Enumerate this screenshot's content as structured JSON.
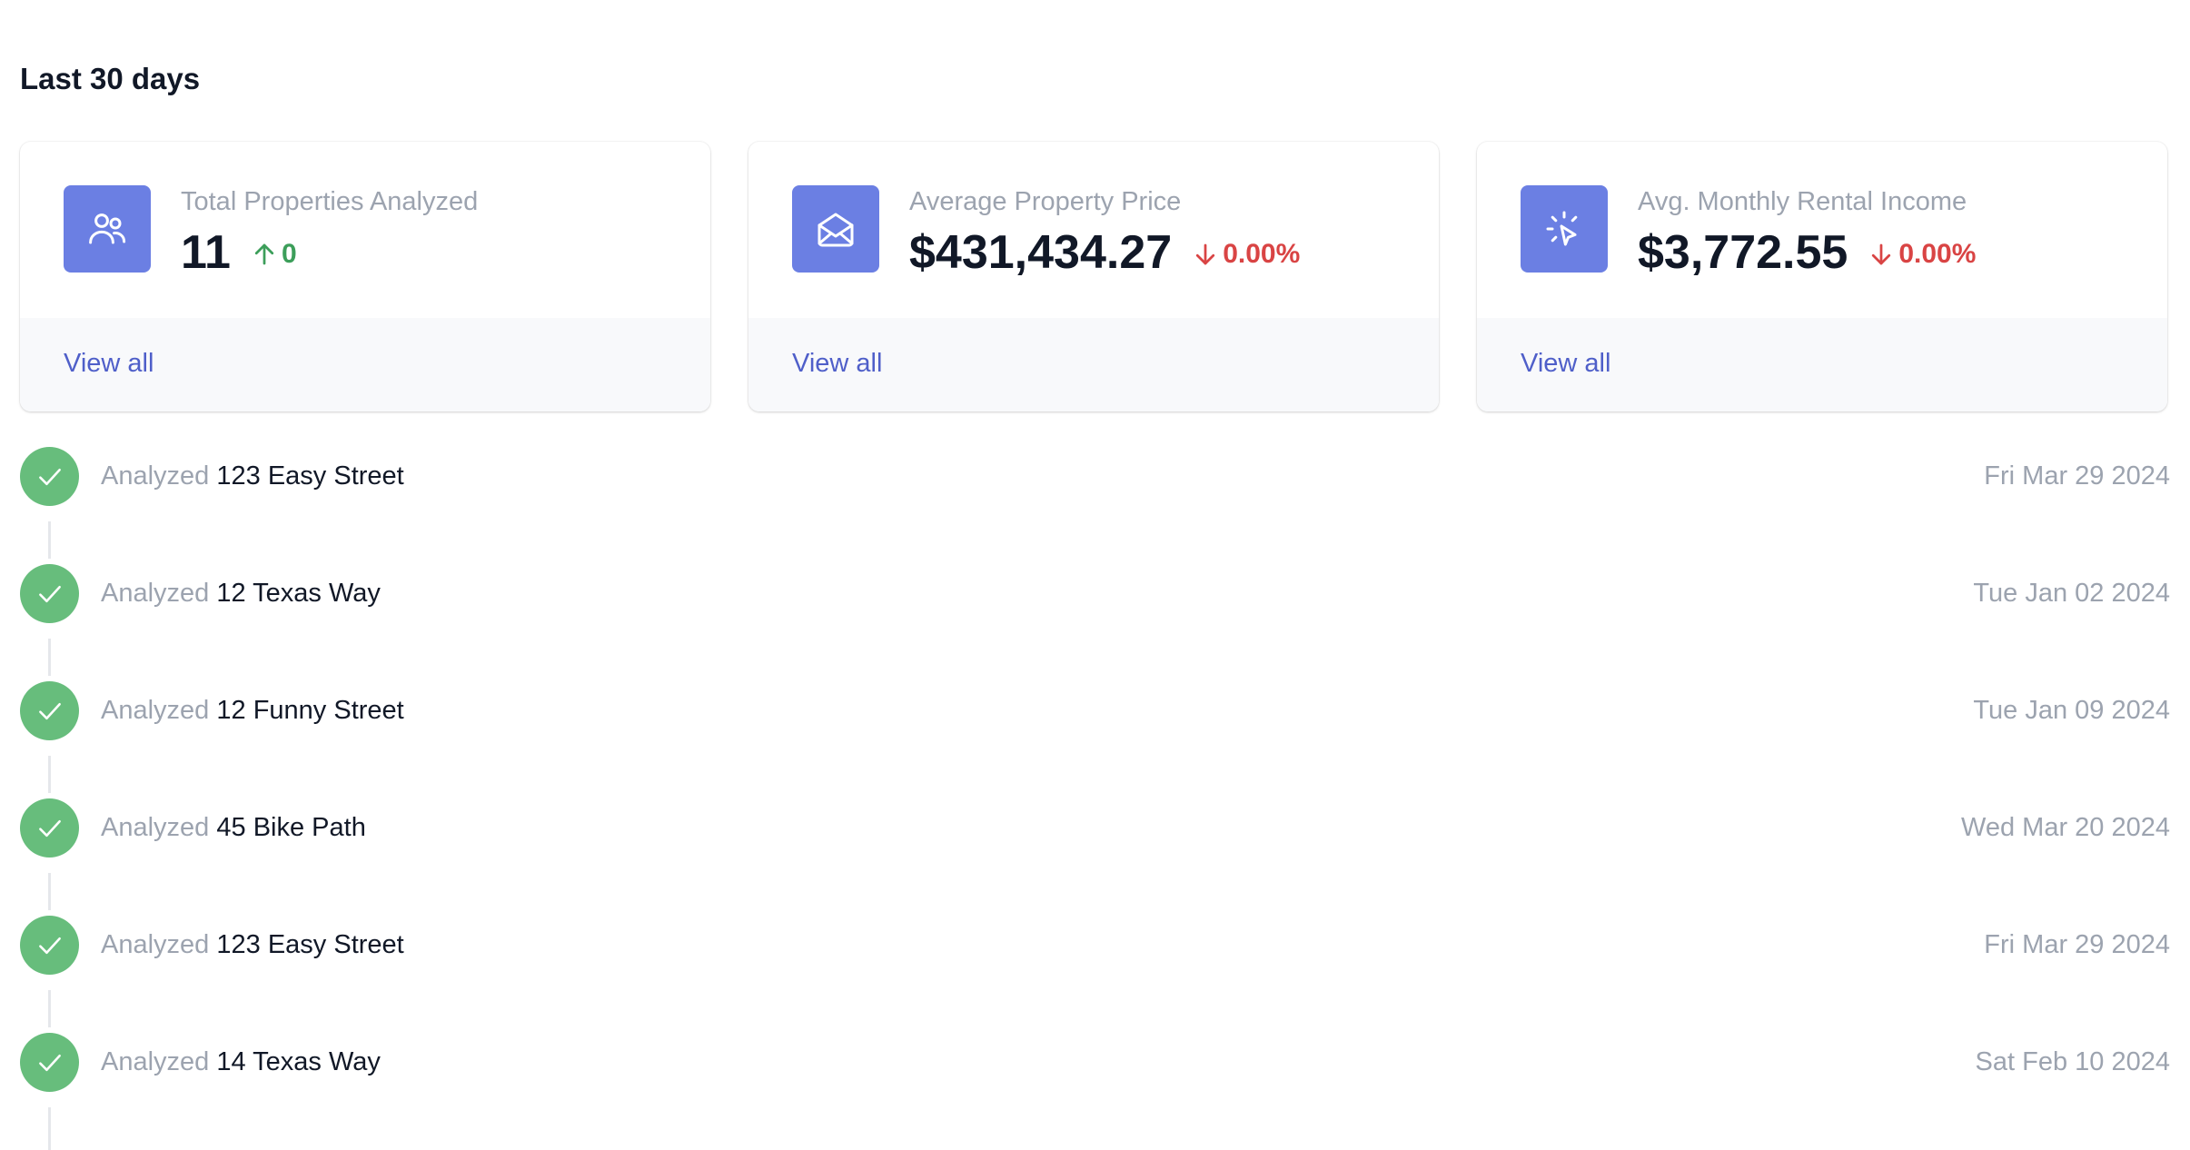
{
  "section_title": "Last 30 days",
  "colors": {
    "icon_bg": "#6b7fe3",
    "up": "#3c9e5a",
    "down": "#d94444",
    "link": "#4f5fc9",
    "check_bg": "#67bd7c"
  },
  "cards": [
    {
      "label": "Total Properties Analyzed",
      "value": "11",
      "change": "0",
      "direction": "up",
      "icon": "users-icon",
      "link": "View all"
    },
    {
      "label": "Average Property Price",
      "value": "$431,434.27",
      "change": "0.00%",
      "direction": "down",
      "icon": "envelope-open-icon",
      "link": "View all"
    },
    {
      "label": "Avg. Monthly Rental Income",
      "value": "$3,772.55",
      "change": "0.00%",
      "direction": "down",
      "icon": "cursor-click-icon",
      "link": "View all"
    }
  ],
  "feed": [
    {
      "verb": "Analyzed",
      "address": "123 Easy Street",
      "date": "Fri Mar 29 2024"
    },
    {
      "verb": "Analyzed",
      "address": "12 Texas Way",
      "date": "Tue Jan 02 2024"
    },
    {
      "verb": "Analyzed",
      "address": "12 Funny Street",
      "date": "Tue Jan 09 2024"
    },
    {
      "verb": "Analyzed",
      "address": "45 Bike Path",
      "date": "Wed Mar 20 2024"
    },
    {
      "verb": "Analyzed",
      "address": "123 Easy Street",
      "date": "Fri Mar 29 2024"
    },
    {
      "verb": "Analyzed",
      "address": "14 Texas Way",
      "date": "Sat Feb 10 2024"
    }
  ]
}
